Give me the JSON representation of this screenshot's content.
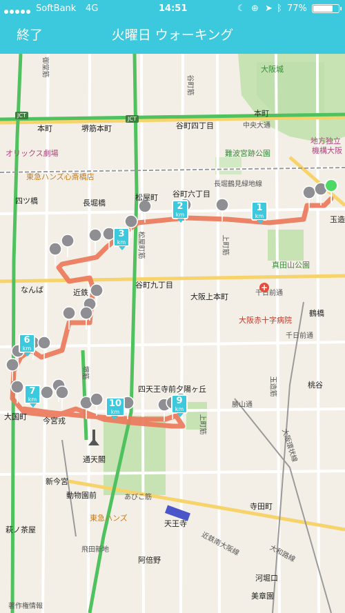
{
  "status_bar": {
    "carrier": "SoftBank",
    "network": "4G",
    "time": "14:51",
    "battery": "77%",
    "battery_level": 0.77
  },
  "nav": {
    "done_label": "終了",
    "title": "火曜日 ウォーキング"
  },
  "colors": {
    "accent": "#3cc9dd",
    "route": "#ec7a5c",
    "highway": "#4fc25f",
    "start_pin": "#4cd964",
    "photo_pin": "#8e8e93"
  },
  "map": {
    "labels": [
      {
        "text": "大阪城"
      },
      {
        "text": "本町"
      },
      {
        "text": "堺筋本町"
      },
      {
        "text": "谷町四丁目"
      },
      {
        "text": "中央大通"
      },
      {
        "text": "地方独立"
      },
      {
        "text": "機構大阪"
      },
      {
        "text": "オリックス劇場"
      },
      {
        "text": "難波宮跡公園"
      },
      {
        "text": "東急ハンズ心斎橋店"
      },
      {
        "text": "長堀鶴見緑地線"
      },
      {
        "text": "谷町六丁目"
      },
      {
        "text": "四ツ橋"
      },
      {
        "text": "長堀橋"
      },
      {
        "text": "松屋町"
      },
      {
        "text": "玉造"
      },
      {
        "text": "真田山公園"
      },
      {
        "text": "なんば"
      },
      {
        "text": "近鉄"
      },
      {
        "text": "谷町九丁目"
      },
      {
        "text": "千日前通"
      },
      {
        "text": "大阪上本町"
      },
      {
        "text": "鶴橋"
      },
      {
        "text": "大阪赤十字病院"
      },
      {
        "text": "四天王寺前夕陽ヶ丘"
      },
      {
        "text": "桃谷"
      },
      {
        "text": "勝山通"
      },
      {
        "text": "大国町"
      },
      {
        "text": "今宮戎"
      },
      {
        "text": "通天閣"
      },
      {
        "text": "新今宮"
      },
      {
        "text": "動物園前"
      },
      {
        "text": "あびこ筋"
      },
      {
        "text": "寺田町"
      },
      {
        "text": "萩ノ茶屋"
      },
      {
        "text": "東急ハンズ"
      },
      {
        "text": "天王寺"
      },
      {
        "text": "飛田新地"
      },
      {
        "text": "近鉄南大阪線"
      },
      {
        "text": "大和路線"
      },
      {
        "text": "阿倍野"
      },
      {
        "text": "河堀口"
      },
      {
        "text": "美章園"
      },
      {
        "text": "著作権情報"
      },
      {
        "text": "JCT"
      },
      {
        "text": "JCT"
      },
      {
        "text": "千日前通"
      },
      {
        "text": "上町筋"
      },
      {
        "text": "松屋町筋"
      },
      {
        "text": "谷町筋"
      },
      {
        "text": "堺筋"
      },
      {
        "text": "御堂筋"
      },
      {
        "text": "玉造筋"
      },
      {
        "text": "上町筋"
      },
      {
        "text": "大阪環状線"
      }
    ],
    "km_markers": [
      "1",
      "2",
      "3",
      "6",
      "7",
      "9",
      "10"
    ],
    "km_unit": "km"
  }
}
